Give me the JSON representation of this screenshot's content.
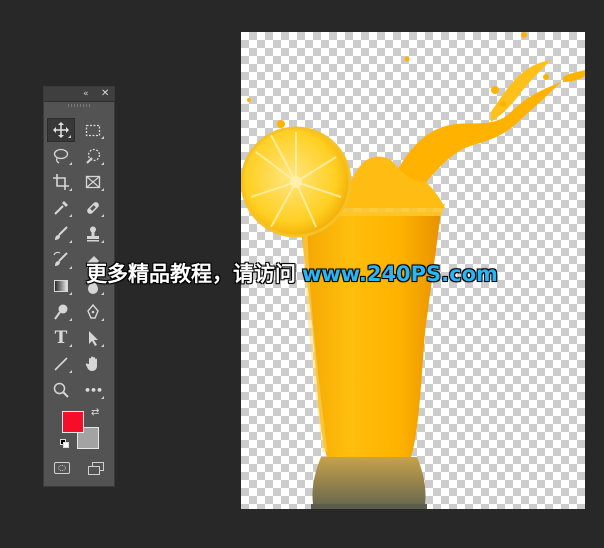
{
  "toolbar": {
    "collapse_glyph": "«",
    "close_glyph": "✕",
    "rows": [
      [
        {
          "name": "move-tool",
          "icon": "move-icon",
          "active": true
        },
        {
          "name": "marquee-tool",
          "icon": "rect-marquee-icon"
        }
      ],
      [
        {
          "name": "lasso-tool",
          "icon": "lasso-icon"
        },
        {
          "name": "quick-selection-tool",
          "icon": "quick-select-icon"
        }
      ],
      [
        {
          "name": "crop-tool",
          "icon": "crop-icon"
        },
        {
          "name": "frame-tool",
          "icon": "frame-icon"
        }
      ],
      [
        {
          "name": "eyedropper-tool",
          "icon": "eyedropper-icon"
        },
        {
          "name": "healing-brush-tool",
          "icon": "bandage-icon"
        }
      ],
      [
        {
          "name": "brush-tool",
          "icon": "brush-icon"
        },
        {
          "name": "clone-stamp-tool",
          "icon": "stamp-icon"
        }
      ],
      [
        {
          "name": "history-brush-tool",
          "icon": "history-brush-icon"
        },
        {
          "name": "eraser-tool",
          "icon": "eraser-icon"
        }
      ],
      [
        {
          "name": "gradient-tool",
          "icon": "gradient-icon"
        },
        {
          "name": "blur-tool",
          "icon": "blur-drop-icon"
        }
      ],
      [
        {
          "name": "dodge-tool",
          "icon": "dodge-icon"
        },
        {
          "name": "pen-tool",
          "icon": "pen-icon"
        }
      ],
      [
        {
          "name": "type-tool",
          "icon": "type-icon",
          "glyph": "T"
        },
        {
          "name": "path-selection-tool",
          "icon": "arrow-icon"
        }
      ],
      [
        {
          "name": "line-tool",
          "icon": "line-icon"
        },
        {
          "name": "hand-tool",
          "icon": "hand-icon"
        }
      ],
      [
        {
          "name": "zoom-tool",
          "icon": "zoom-icon"
        },
        {
          "name": "more-tools",
          "icon": "more-icon",
          "glyph": "•••"
        }
      ]
    ],
    "foreground_color": "#f50d2a",
    "background_color": "#a3a3a3"
  },
  "watermark": {
    "cn_text": "更多精品教程，请访问",
    "url_text": "www.240PS.com",
    "url_color": "#29b6f6"
  }
}
